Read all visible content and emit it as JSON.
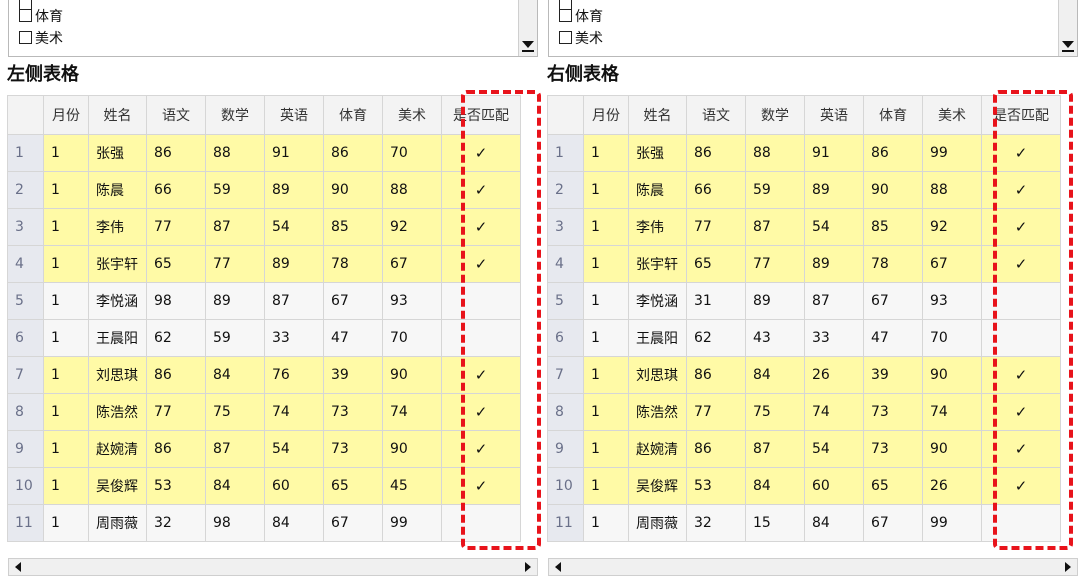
{
  "left": {
    "title": "左侧表格",
    "checkbox_items": [
      "体育",
      "美术"
    ],
    "headers": [
      "月份",
      "姓名",
      "语文",
      "数学",
      "英语",
      "体育",
      "美术",
      "是否匹配"
    ],
    "rows": [
      {
        "num": "1",
        "cells": [
          "1",
          "张强",
          "86",
          "88",
          "91",
          "86",
          "70"
        ],
        "match": "✓"
      },
      {
        "num": "2",
        "cells": [
          "1",
          "陈晨",
          "66",
          "59",
          "89",
          "90",
          "88"
        ],
        "match": "✓"
      },
      {
        "num": "3",
        "cells": [
          "1",
          "李伟",
          "77",
          "87",
          "54",
          "85",
          "92"
        ],
        "match": "✓"
      },
      {
        "num": "4",
        "cells": [
          "1",
          "张宇轩",
          "65",
          "77",
          "89",
          "78",
          "67"
        ],
        "match": "✓"
      },
      {
        "num": "5",
        "cells": [
          "1",
          "李悦涵",
          "98",
          "89",
          "87",
          "67",
          "93"
        ],
        "match": ""
      },
      {
        "num": "6",
        "cells": [
          "1",
          "王晨阳",
          "62",
          "59",
          "33",
          "47",
          "70"
        ],
        "match": ""
      },
      {
        "num": "7",
        "cells": [
          "1",
          "刘思琪",
          "86",
          "84",
          "76",
          "39",
          "90"
        ],
        "match": "✓"
      },
      {
        "num": "8",
        "cells": [
          "1",
          "陈浩然",
          "77",
          "75",
          "74",
          "73",
          "74"
        ],
        "match": "✓"
      },
      {
        "num": "9",
        "cells": [
          "1",
          "赵婉清",
          "86",
          "87",
          "54",
          "73",
          "90"
        ],
        "match": "✓"
      },
      {
        "num": "10",
        "cells": [
          "1",
          "吴俊辉",
          "53",
          "84",
          "60",
          "65",
          "45"
        ],
        "match": "✓"
      },
      {
        "num": "11",
        "cells": [
          "1",
          "周雨薇",
          "32",
          "98",
          "84",
          "67",
          "99"
        ],
        "match": ""
      }
    ]
  },
  "right": {
    "title": "右侧表格",
    "checkbox_items": [
      "体育",
      "美术"
    ],
    "headers": [
      "月份",
      "姓名",
      "语文",
      "数学",
      "英语",
      "体育",
      "美术",
      "是否匹配"
    ],
    "rows": [
      {
        "num": "1",
        "cells": [
          "1",
          "张强",
          "86",
          "88",
          "91",
          "86",
          "99"
        ],
        "match": "✓"
      },
      {
        "num": "2",
        "cells": [
          "1",
          "陈晨",
          "66",
          "59",
          "89",
          "90",
          "88"
        ],
        "match": "✓"
      },
      {
        "num": "3",
        "cells": [
          "1",
          "李伟",
          "77",
          "87",
          "54",
          "85",
          "92"
        ],
        "match": "✓"
      },
      {
        "num": "4",
        "cells": [
          "1",
          "张宇轩",
          "65",
          "77",
          "89",
          "78",
          "67"
        ],
        "match": "✓"
      },
      {
        "num": "5",
        "cells": [
          "1",
          "李悦涵",
          "31",
          "89",
          "87",
          "67",
          "93"
        ],
        "match": ""
      },
      {
        "num": "6",
        "cells": [
          "1",
          "王晨阳",
          "62",
          "43",
          "33",
          "47",
          "70"
        ],
        "match": ""
      },
      {
        "num": "7",
        "cells": [
          "1",
          "刘思琪",
          "86",
          "84",
          "26",
          "39",
          "90"
        ],
        "match": "✓"
      },
      {
        "num": "8",
        "cells": [
          "1",
          "陈浩然",
          "77",
          "75",
          "74",
          "73",
          "74"
        ],
        "match": "✓"
      },
      {
        "num": "9",
        "cells": [
          "1",
          "赵婉清",
          "86",
          "87",
          "54",
          "73",
          "90"
        ],
        "match": "✓"
      },
      {
        "num": "10",
        "cells": [
          "1",
          "吴俊辉",
          "53",
          "84",
          "60",
          "65",
          "26"
        ],
        "match": "✓"
      },
      {
        "num": "11",
        "cells": [
          "1",
          "周雨薇",
          "32",
          "15",
          "84",
          "67",
          "99"
        ],
        "match": ""
      }
    ]
  },
  "colors": {
    "match_row": "#fffaa6",
    "highlight_border": "#e8131b"
  }
}
